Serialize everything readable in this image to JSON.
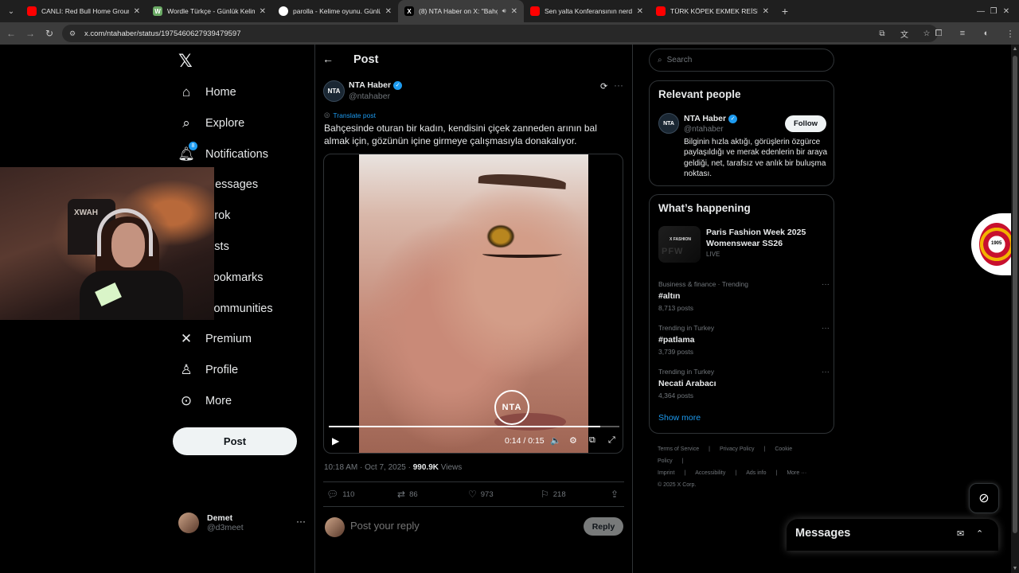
{
  "browser": {
    "tabs": [
      {
        "title": "CANLI: Red Bull Home Ground",
        "favicon_color": "#ff0000",
        "active": false
      },
      {
        "title": "Wordle Türkçe - Günlük Kelime",
        "favicon_color": "#6aaa64",
        "favicon_text": "W",
        "active": false
      },
      {
        "title": "parolla - Kelime oyunu. Günlük",
        "favicon_color": "#ffffff",
        "active": false
      },
      {
        "title": "(8) NTA Haber on X: \"Bahçe",
        "favicon_color": "#000000",
        "favicon_text": "X",
        "active": true
      },
      {
        "title": "Sen yalta Konferansının nerde o",
        "favicon_color": "#ff0000",
        "active": false
      },
      {
        "title": "TÜRK KÖPEK EKMEK REİSİ NASI",
        "favicon_color": "#ff0000",
        "active": false
      }
    ],
    "url": "x.com/ntahaber/status/1975460627939479597"
  },
  "nav": {
    "items": [
      {
        "label": "Home",
        "icon": "home-icon"
      },
      {
        "label": "Explore",
        "icon": "search-icon"
      },
      {
        "label": "Notifications",
        "icon": "bell-icon",
        "badge": "8"
      },
      {
        "label": "Messages",
        "icon": "envelope-icon"
      },
      {
        "label": "Grok",
        "icon": "grok-icon"
      },
      {
        "label": "Lists",
        "icon": "list-icon"
      },
      {
        "label": "Bookmarks",
        "icon": "bookmark-icon"
      },
      {
        "label": "Communities",
        "icon": "people-icon"
      },
      {
        "label": "Premium",
        "icon": "x-icon"
      },
      {
        "label": "Profile",
        "icon": "person-icon"
      },
      {
        "label": "More",
        "icon": "more-circle-icon"
      }
    ],
    "post_label": "Post",
    "account": {
      "name": "Demet",
      "handle": "@d3meet"
    }
  },
  "post": {
    "heading": "Post",
    "author": {
      "name": "NTA Haber",
      "handle": "@ntahaber",
      "avatar_text": "NTA"
    },
    "translate_label": "Translate post",
    "text": "Bahçesinde oturan bir kadın, kendisini çiçek zanneden arının bal almak için, gözünün içine girmeye çalışmasıyla donakalıyor.",
    "video": {
      "watermark": "NTA",
      "time": "0:14 / 0:15",
      "progress": 0.933
    },
    "meta": {
      "time": "10:18 AM · Oct 7, 2025 · ",
      "views_count": "990.9K",
      "views_label": " Views"
    },
    "stats": {
      "replies": "110",
      "reposts": "86",
      "likes": "973",
      "bookmarks": "218"
    },
    "reply_placeholder": "Post your reply",
    "reply_button": "Reply"
  },
  "sidebar": {
    "search_placeholder": "Search",
    "relevant": {
      "heading": "Relevant people",
      "name": "NTA Haber",
      "handle": "@ntahaber",
      "follow_label": "Follow",
      "bio": "Bilginin hızla aktığı, görüşlerin özgürce paylaşıldığı ve merak edenlerin bir araya geldiği, net, tarafsız ve anlık bir buluşma noktası."
    },
    "happening": {
      "heading": "What’s happening",
      "featured": {
        "title": "Paris Fashion Week 2025 Womenswear SS26",
        "status": "LIVE",
        "thumb_label": "X FASHION",
        "thumb_text": "PFW"
      },
      "trends": [
        {
          "context": "Business & finance · Trending",
          "name": "#altın",
          "count": "8,713 posts"
        },
        {
          "context": "Trending in Turkey",
          "name": "#patlama",
          "count": "3,739 posts"
        },
        {
          "context": "Trending in Turkey",
          "name": "Necati Arabacı",
          "count": "4,364 posts"
        }
      ],
      "show_more": "Show more"
    },
    "footer": {
      "line1": [
        "Terms of Service",
        "|",
        "Privacy Policy",
        "|",
        "Cookie Policy",
        "|"
      ],
      "line2": [
        "Imprint",
        "|",
        "Accessibility",
        "|",
        "Ads info",
        "|",
        "More ···"
      ],
      "copyright": "© 2025 X Corp."
    }
  },
  "overlay": {
    "badge_year": "1905",
    "messages_title": "Messages",
    "webcam_text": "XWAH"
  }
}
